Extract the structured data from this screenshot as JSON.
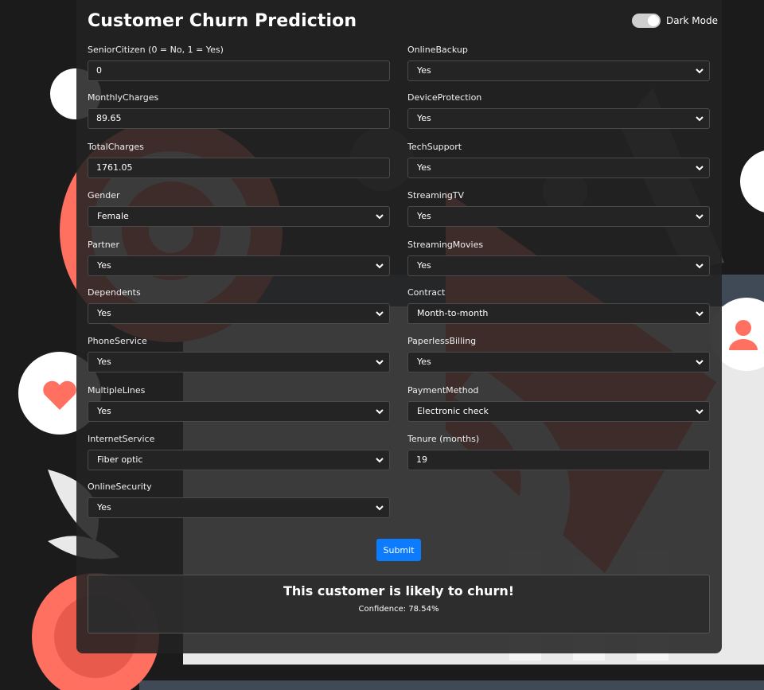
{
  "header": {
    "title": "Customer Churn Prediction",
    "toggle_label": "Dark Mode",
    "dark_mode": true
  },
  "form": {
    "left": [
      {
        "label": "SeniorCitizen (0 = No, 1 = Yes)",
        "type": "input",
        "value": "0"
      },
      {
        "label": "MonthlyCharges",
        "type": "input",
        "value": "89.65"
      },
      {
        "label": "TotalCharges",
        "type": "input",
        "value": "1761.05"
      },
      {
        "label": "Gender",
        "type": "select",
        "value": "Female"
      },
      {
        "label": "Partner",
        "type": "select",
        "value": "Yes"
      },
      {
        "label": "Dependents",
        "type": "select",
        "value": "Yes"
      },
      {
        "label": "PhoneService",
        "type": "select",
        "value": "Yes"
      },
      {
        "label": "MultipleLines",
        "type": "select",
        "value": "Yes"
      },
      {
        "label": "InternetService",
        "type": "select",
        "value": "Fiber optic"
      },
      {
        "label": "OnlineSecurity",
        "type": "select",
        "value": "Yes"
      }
    ],
    "right": [
      {
        "label": "OnlineBackup",
        "type": "select",
        "value": "Yes"
      },
      {
        "label": "DeviceProtection",
        "type": "select",
        "value": "Yes"
      },
      {
        "label": "TechSupport",
        "type": "select",
        "value": "Yes"
      },
      {
        "label": "StreamingTV",
        "type": "select",
        "value": "Yes"
      },
      {
        "label": "StreamingMovies",
        "type": "select",
        "value": "Yes"
      },
      {
        "label": "Contract",
        "type": "select",
        "value": "Month-to-month"
      },
      {
        "label": "PaperlessBilling",
        "type": "select",
        "value": "Yes"
      },
      {
        "label": "PaymentMethod",
        "type": "select",
        "value": "Electronic check"
      },
      {
        "label": "Tenure (months)",
        "type": "input",
        "value": "19"
      }
    ],
    "submit_label": "Submit"
  },
  "result": {
    "message": "This customer is likely to churn!",
    "confidence": "Confidence: 78.54%"
  },
  "colors": {
    "accent": "#0d7bfd",
    "illustration": "#ff7060",
    "card": "#222222"
  }
}
